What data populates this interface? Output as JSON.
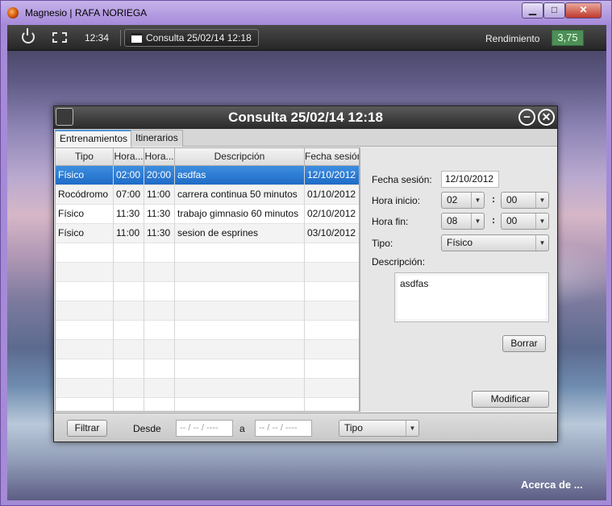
{
  "window": {
    "title": "Magnesio | RAFA NORIEGA",
    "min_glyph": "▁",
    "max_glyph": "□",
    "close_glyph": "✕"
  },
  "topbar": {
    "time": "12:34",
    "task_label": "Consulta 25/02/14 12:18",
    "rendimiento_label": "Rendimiento",
    "rendimiento_value": "3,75"
  },
  "about_link": "Acerca de ...",
  "dialog": {
    "title": "Consulta 25/02/14 12:18",
    "min_glyph": "−",
    "close_glyph": "✕",
    "tabs": [
      {
        "label": "Entrenamientos",
        "active": true
      },
      {
        "label": "Itinerarios",
        "active": false
      }
    ],
    "table": {
      "headers": [
        "Tipo",
        "Hora...",
        "Hora...",
        "Descripción",
        "Fecha sesión"
      ],
      "rows": [
        {
          "tipo": "Físico",
          "hora_inicio": "02:00",
          "hora_fin": "20:00",
          "descripcion": "asdfas",
          "fecha": "12/10/2012"
        },
        {
          "tipo": "Rocódromo",
          "hora_inicio": "07:00",
          "hora_fin": "11:00",
          "descripcion": "carrera continua 50 minutos",
          "fecha": "01/10/2012"
        },
        {
          "tipo": "Físico",
          "hora_inicio": "11:30",
          "hora_fin": "11:30",
          "descripcion": "trabajo gimnasio 60 minutos",
          "fecha": "02/10/2012"
        },
        {
          "tipo": "Físico",
          "hora_inicio": "11:00",
          "hora_fin": "11:30",
          "descripcion": "sesion de esprines",
          "fecha": "03/10/2012"
        }
      ],
      "selected_row": 0
    },
    "form": {
      "fecha_label": "Fecha sesión:",
      "fecha_value": "12/10/2012",
      "hora_inicio_label": "Hora inicio:",
      "hora_inicio_h": "02",
      "hora_inicio_m": "00",
      "hora_fin_label": "Hora fin:",
      "hora_fin_h": "08",
      "hora_fin_m": "00",
      "time_separator": ":",
      "tipo_label": "Tipo:",
      "tipo_value": "Físico",
      "descripcion_label": "Descripción:",
      "descripcion_value": "asdfas",
      "borrar_label": "Borrar",
      "modificar_label": "Modificar"
    },
    "filter": {
      "filtrar_label": "Filtrar",
      "desde_label": "Desde",
      "desde_placeholder": "-- / -- / ----",
      "a_label": "a",
      "hasta_placeholder": "-- / -- / ----",
      "tipo_placeholder": "Tipo"
    }
  }
}
